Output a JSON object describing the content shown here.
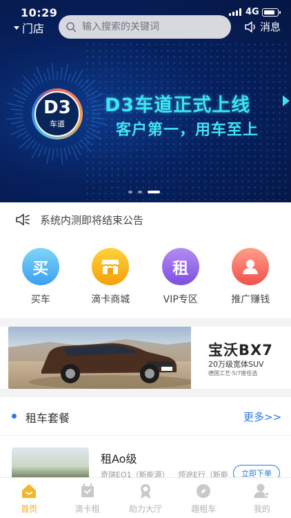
{
  "status_bar": {
    "time": "10:29",
    "network": "4G",
    "battery_level": 0.85
  },
  "header": {
    "store_label": "门店",
    "search_placeholder": "输入搜索的关键词",
    "messages_label": "消息"
  },
  "banner": {
    "badge_big": "D3",
    "badge_small": "车道",
    "headline": "D3车道正式上线",
    "subline": "客户第一，用车至上",
    "slide_count": 3,
    "active_slide": 3,
    "colors": {
      "accent": "#3fe3f2",
      "background": "#07215e"
    }
  },
  "notice": {
    "text": "系统内测即将结束公告",
    "icon": "speaker-icon"
  },
  "quick_links": [
    {
      "label": "买车",
      "glyph": "买",
      "icon": "buy-car-icon",
      "color_from": "#7fd6f7",
      "color_to": "#3a9ff0"
    },
    {
      "label": "滴卡商城",
      "glyph": "",
      "icon": "shop-icon",
      "color_from": "#ffd23a",
      "color_to": "#f5a10a"
    },
    {
      "label": "VIP专区",
      "glyph": "租",
      "icon": "vip-rent-icon",
      "color_from": "#b58cf2",
      "color_to": "#7b4fe0"
    },
    {
      "label": "推广赚钱",
      "glyph": "",
      "icon": "user-promo-icon",
      "color_from": "#ff9f8a",
      "color_to": "#f0504a"
    }
  ],
  "ad": {
    "brand": "宝沃BX7",
    "subtitle": "20万级宽体SUV",
    "note": "德国工艺·5/7座任选"
  },
  "section": {
    "title": "租车套餐",
    "more": "更多>>"
  },
  "package": {
    "title": "租Ao级",
    "desc1": "奇瑞EQ1（新能源）",
    "desc2": "领途E行（新能",
    "button": "立即下单"
  },
  "tabbar": [
    {
      "label": "首页",
      "icon": "home-icon",
      "active": true
    },
    {
      "label": "滴卡租",
      "icon": "card-rent-icon",
      "active": false
    },
    {
      "label": "助力大厅",
      "icon": "medal-icon",
      "active": false
    },
    {
      "label": "趣租车",
      "icon": "compass-icon",
      "active": false
    },
    {
      "label": "我的",
      "icon": "profile-icon",
      "active": false
    }
  ]
}
